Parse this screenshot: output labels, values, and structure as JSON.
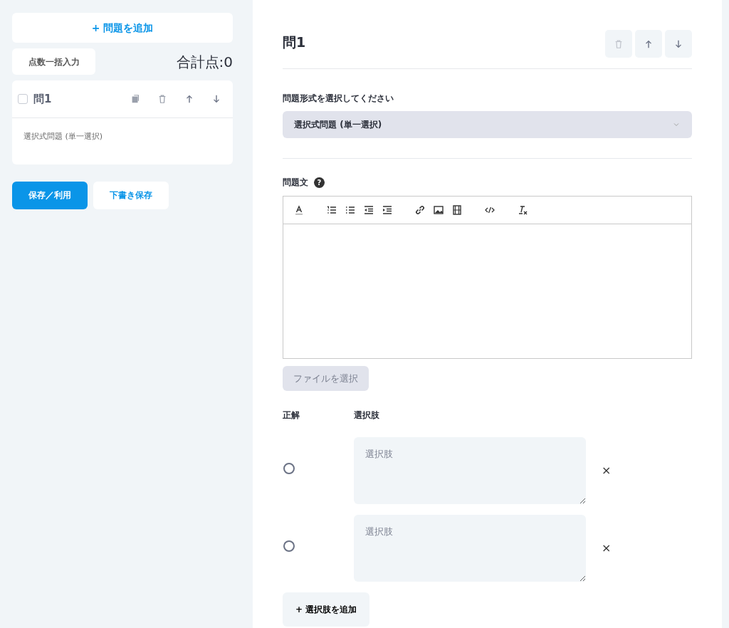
{
  "sidebar": {
    "add_question_button": "+ 問題を追加",
    "bulk_score_button": "点数一括入力",
    "total_score": "合計点:0",
    "questions": [
      {
        "title": "問1",
        "checked": false,
        "type": "選択式問題 (単一選択)"
      }
    ],
    "save_button": "保存／利用",
    "draft_button": "下書き保存"
  },
  "editor": {
    "title": "問1",
    "type_label": "問題形式を選択してください",
    "type_value": "選択式問題 (単一選択)",
    "body_label": "問題文",
    "help_icon": "?",
    "file_button": "ファイルを選択",
    "columns": [
      "正解",
      "選択肢"
    ],
    "choices": [
      {
        "placeholder": "選択肢",
        "selected": false,
        "remove": "×"
      },
      {
        "placeholder": "選択肢",
        "selected": false,
        "remove": "×"
      }
    ],
    "add_choice_button": "+ 選択肢を追加"
  }
}
